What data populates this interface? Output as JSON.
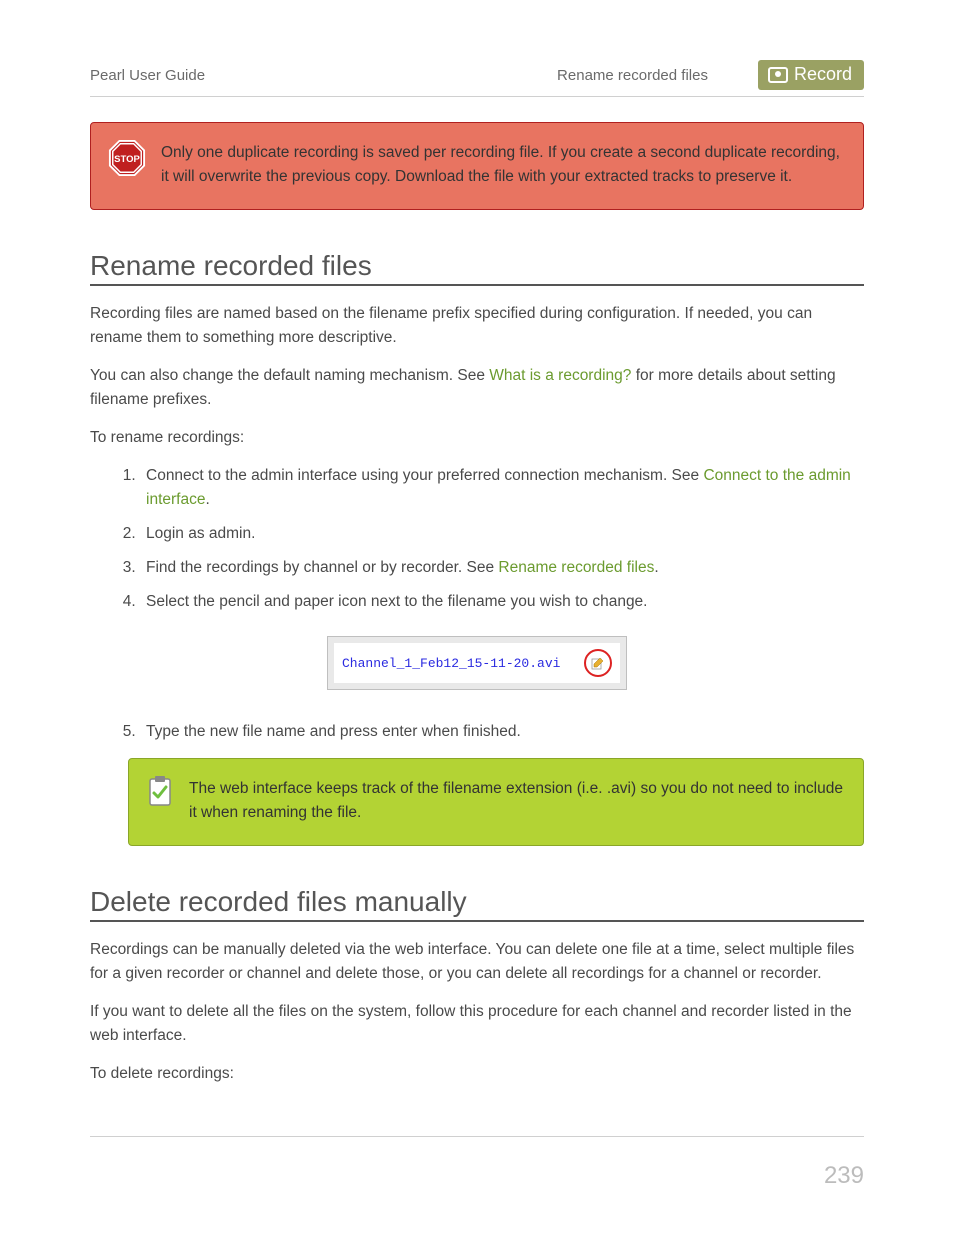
{
  "header": {
    "guide": "Pearl User Guide",
    "section": "Rename recorded files",
    "badge": "Record"
  },
  "alert": {
    "text": "Only one duplicate recording is saved per recording file. If you create a second duplicate recording, it will overwrite the previous copy. Download the file with your extracted tracks to preserve it."
  },
  "section1": {
    "heading": "Rename recorded files",
    "p1": "Recording files are named based on the filename prefix specified during configuration. If needed, you can rename them to something more descriptive.",
    "p2a": "You can also change the default naming mechanism. See ",
    "p2_link": "What is a recording?",
    "p2b": " for more details about setting filename prefixes.",
    "p3": "To rename recordings:",
    "steps": {
      "s1a": "Connect to the admin interface using your preferred connection mechanism. See ",
      "s1_link": "Connect to the admin interface",
      "s1b": ".",
      "s2": "Login as admin.",
      "s3a": "Find the recordings by channel or by recorder. See ",
      "s3_link": "Rename recorded files",
      "s3b": ".",
      "s4": "Select the pencil and paper icon next to the filename you wish to change.",
      "s5": "Type the new file name and press enter when finished."
    },
    "filename": "Channel_1_Feb12_15-11-20.avi"
  },
  "note": {
    "text": "The web interface keeps track of the filename extension (i.e. .avi) so you do not need to include it when renaming the file."
  },
  "section2": {
    "heading": "Delete recorded files manually",
    "p1": "Recordings can be manually deleted via the web interface. You can delete one file at a time, select multiple files for a given recorder or channel and delete those, or you can delete all recordings for a channel or recorder.",
    "p2": "If you want to delete all the files on the system, follow this procedure for each channel and recorder listed in the web interface.",
    "p3": "To delete recordings:"
  },
  "page_number": "239"
}
